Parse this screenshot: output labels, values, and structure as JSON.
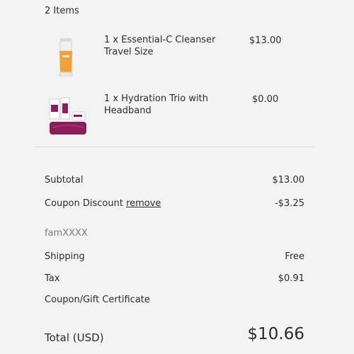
{
  "cart": {
    "items_count": "2 Items",
    "items": [
      {
        "description": "1 x Essential-C Cleanser Travel Size",
        "price": "$13.00",
        "image_icon": "cleanser-tube-icon"
      },
      {
        "description": "1 x Hydration Trio with Headband",
        "price": "$0.00",
        "image_icon": "hydration-trio-icon"
      }
    ]
  },
  "summary": {
    "subtotal_label": "Subtotal",
    "subtotal_value": "$13.00",
    "coupon_label": "Coupon Discount",
    "remove_label": "remove",
    "coupon_value": "-$3.25",
    "coupon_code": "famXXXX",
    "shipping_label": "Shipping",
    "shipping_value": "Free",
    "tax_label": "Tax",
    "tax_value": "$0.91",
    "gift_label": "Coupon/Gift Certificate",
    "total_label": "Total (USD)",
    "total_value": "$10.66"
  },
  "colors": {
    "background": "#f3f3f3",
    "text": "#2b2b2b",
    "muted": "#7a7a7a",
    "product_accent": "#8c1d5c",
    "cleanser_orange": "#f0a13a"
  }
}
